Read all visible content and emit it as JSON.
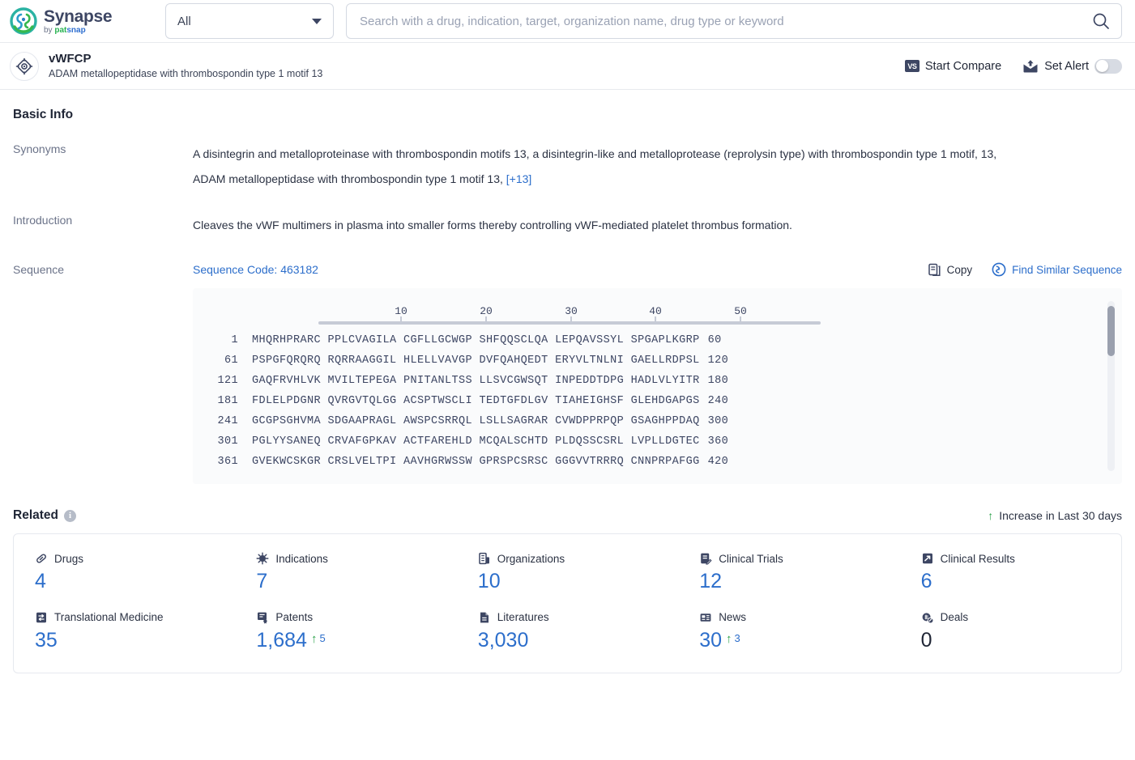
{
  "brand": {
    "name": "Synapse",
    "by": "by",
    "pat": "pat",
    "snap": "snap",
    "logo_green": "#28b351",
    "logo_blue": "#2f6fd0",
    "logo_navy": "#3d4663"
  },
  "search": {
    "scope_value": "All",
    "placeholder": "Search with a drug, indication, target, organization name, drug type or keyword",
    "value": "",
    "search_icon": "search-icon",
    "caret_icon": "chevron-down-icon"
  },
  "entity": {
    "icon": "target-icon",
    "title": "vWFCP",
    "subtitle": "ADAM metallopeptidase with thrombospondin type 1 motif 13",
    "compare_label": "Start Compare",
    "compare_badge": "VS",
    "alert_label": "Set Alert",
    "alert_icon": "mail-alert-icon",
    "alert_enabled": false
  },
  "basic_info": {
    "heading": "Basic Info",
    "rows": [
      {
        "label": "Synonyms",
        "line1": "A disintegrin and metalloproteinase with thrombospondin motifs 13,  a disintegrin-like and metalloprotease (reprolysin type) with thrombospondin type 1 motif, 13,",
        "line2": "ADAM metallopeptidase with thrombospondin type 1 motif 13,",
        "more": "[+13]"
      },
      {
        "label": "Introduction",
        "line1": "Cleaves the vWF multimers in plasma into smaller forms thereby controlling vWF-mediated platelet thrombus formation."
      }
    ]
  },
  "sequence": {
    "label": "Sequence",
    "code_label": "Sequence Code: 463182",
    "copy_label": "Copy",
    "copy_icon": "copy-icon",
    "similar_label": "Find Similar Sequence",
    "similar_icon": "find-similar-icon",
    "ruler_ticks": [
      "10",
      "20",
      "30",
      "40",
      "50"
    ],
    "rows": [
      {
        "start": "1",
        "blocks": "MHQRHPRARC PPLCVAGILA CGFLLGCWGP SHFQQSCLQA LEPQAVSSYL SPGAPLKGRP",
        "end": "60"
      },
      {
        "start": "61",
        "blocks": "PSPGFQRQRQ RQRRAAGGIL HLELLVAVGP DVFQAHQEDT ERYVLTNLNI GAELLRDPSL",
        "end": "120"
      },
      {
        "start": "121",
        "blocks": "GAQFRVHLVK MVILTEPEGA PNITANLTSS LLSVCGWSQT INPEDDTDPG HADLVLYITR",
        "end": "180"
      },
      {
        "start": "181",
        "blocks": "FDLELPDGNR QVRGVTQLGG ACSPTWSCLI TEDTGFDLGV TIAHEIGHSF GLEHDGAPGS",
        "end": "240"
      },
      {
        "start": "241",
        "blocks": "GCGPSGHVMA SDGAAPRAGL AWSPCSRRQL LSLLSAGRAR CVWDPPRPQP GSAGHPPDAQ",
        "end": "300"
      },
      {
        "start": "301",
        "blocks": "PGLYYSANEQ CRVAFGPKAV ACTFAREHLD MCQALSCHTD PLDQSSCSRL LVPLLDGTEC",
        "end": "360"
      },
      {
        "start": "361",
        "blocks": "GVEKWCSKGR CRSLVELTPI AAVHGRWSSW GPRSPCSRSC GGGVVTRRRQ CNNPRPAFGG",
        "end": "420"
      }
    ]
  },
  "related": {
    "heading": "Related",
    "info_icon": "info-icon",
    "legend_label": "Increase in Last 30 days",
    "legend_icon": "arrow-up-icon",
    "stats": [
      {
        "label": "Drugs",
        "icon": "pill-icon",
        "value": "4"
      },
      {
        "label": "Indications",
        "icon": "virus-icon",
        "value": "7"
      },
      {
        "label": "Organizations",
        "icon": "building-icon",
        "value": "10"
      },
      {
        "label": "Clinical Trials",
        "icon": "clipboard-icon",
        "value": "12"
      },
      {
        "label": "Clinical Results",
        "icon": "results-icon",
        "value": "6"
      },
      {
        "label": "Translational Medicine",
        "icon": "translation-icon",
        "value": "35"
      },
      {
        "label": "Patents",
        "icon": "patent-icon",
        "value": "1,684",
        "delta": "5"
      },
      {
        "label": "Literatures",
        "icon": "document-icon",
        "value": "3,030"
      },
      {
        "label": "News",
        "icon": "news-icon",
        "value": "30",
        "delta": "3"
      },
      {
        "label": "Deals",
        "icon": "deal-icon",
        "value": "0",
        "zero": true
      }
    ]
  }
}
